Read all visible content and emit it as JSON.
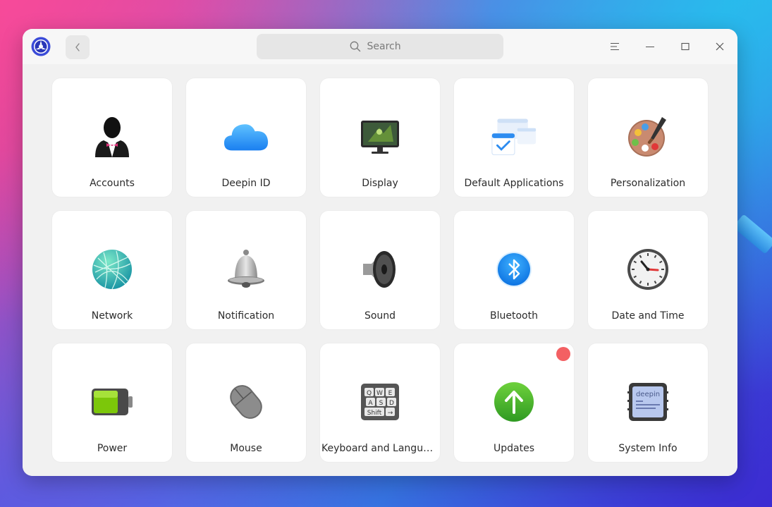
{
  "search": {
    "placeholder": "Search"
  },
  "tiles": [
    {
      "label": "Accounts"
    },
    {
      "label": "Deepin ID"
    },
    {
      "label": "Display"
    },
    {
      "label": "Default Applications"
    },
    {
      "label": "Personalization"
    },
    {
      "label": "Network"
    },
    {
      "label": "Notification"
    },
    {
      "label": "Sound"
    },
    {
      "label": "Bluetooth"
    },
    {
      "label": "Date and Time"
    },
    {
      "label": "Power"
    },
    {
      "label": "Mouse"
    },
    {
      "label": "Keyboard and Language"
    },
    {
      "label": "Updates"
    },
    {
      "label": "System Info"
    }
  ],
  "keyboard_keys": [
    "Q",
    "W",
    "E",
    "A",
    "S",
    "D",
    "Shift",
    "→"
  ],
  "system_info_brand": "deepin",
  "colors": {
    "update_badge": "#f36063",
    "accent_blue": "#1a8cf0",
    "update_green": "#3fae2c"
  }
}
